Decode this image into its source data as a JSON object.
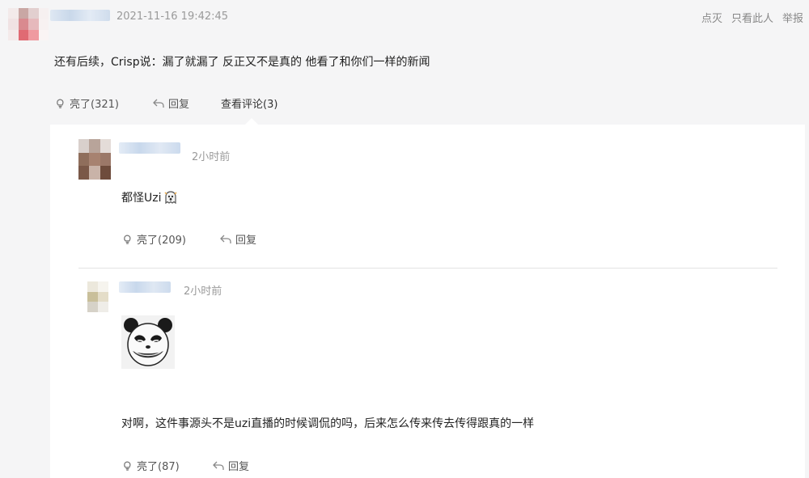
{
  "post": {
    "timestamp": "2021-11-16 19:42:45",
    "top_actions": [
      "点灭",
      "只看此人",
      "举报"
    ],
    "content": "还有后续，Crisp说：漏了就漏了 反正又不是真的 他看了和你们一样的新闻",
    "like_label": "亮了(321)",
    "reply_label": "回复",
    "view_comments_label": "查看评论(3)"
  },
  "comments": [
    {
      "time": "2小时前",
      "content": "都怪Uzi",
      "emoji_icon": "ghost-emoji-icon",
      "like_label": "亮了(209)",
      "reply_label": "回复"
    },
    {
      "time": "2小时前",
      "sticker_icon": "panda-meme-icon",
      "content": "对啊，这件事源头不是uzi直播的时候调侃的吗，后来怎么传来传去传得跟真的一样",
      "like_label": "亮了(87)",
      "reply_label": "回复"
    }
  ],
  "colors": {
    "background": "#f5f5f6",
    "panel": "#ffffff",
    "meta_text": "#9a9a9a",
    "action_text": "#555555"
  }
}
